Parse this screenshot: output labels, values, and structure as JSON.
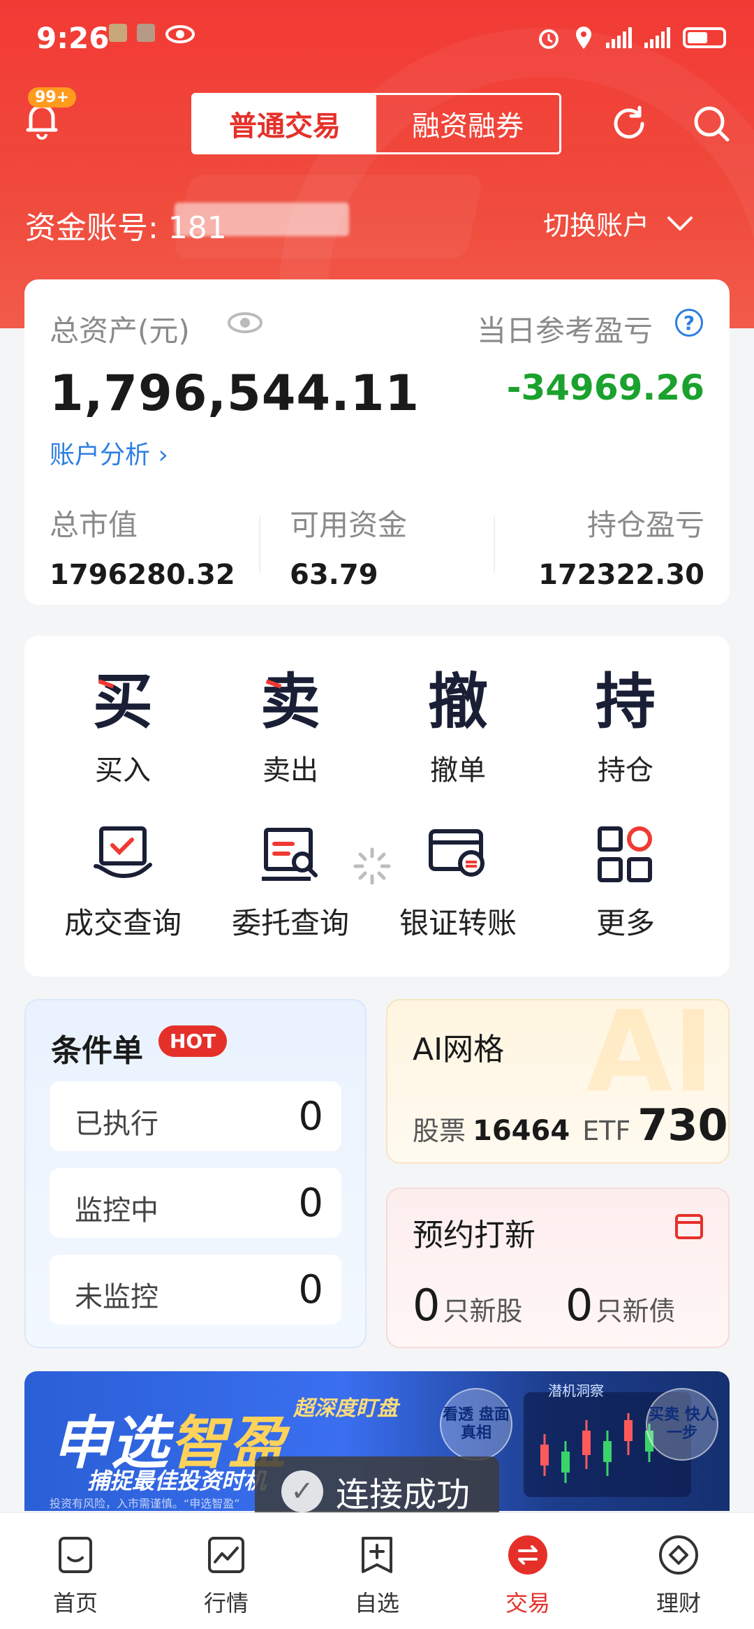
{
  "status_bar": {
    "time": "9:26"
  },
  "top_bar": {
    "badge": "99+",
    "tabs": [
      {
        "label": "普通交易",
        "active": true
      },
      {
        "label": "融资融券",
        "active": false
      }
    ]
  },
  "account": {
    "label": "资金账号: 181",
    "switch_label": "切换账户"
  },
  "assets": {
    "total_label": "总资产(元)",
    "total_value": "1,796,544.11",
    "daily_pnl_label": "当日参考盈亏",
    "daily_pnl_value": "-34969.26",
    "analysis_link": "账户分析",
    "stats": [
      {
        "label": "总市值",
        "value": "1796280.32"
      },
      {
        "label": "可用资金",
        "value": "63.79"
      },
      {
        "label": "持仓盈亏",
        "value": "172322.30"
      }
    ]
  },
  "functions": {
    "row1": [
      {
        "glyph": "买",
        "label": "买入"
      },
      {
        "glyph": "卖",
        "label": "卖出"
      },
      {
        "glyph": "撤",
        "label": "撤单"
      },
      {
        "glyph": "持",
        "label": "持仓"
      }
    ],
    "row2": [
      {
        "icon": "trade-query-icon",
        "label": "成交查询"
      },
      {
        "icon": "order-query-icon",
        "label": "委托查询"
      },
      {
        "icon": "bank-transfer-icon",
        "label": "银证转账"
      },
      {
        "icon": "more-grid-icon",
        "label": "更多"
      }
    ]
  },
  "conditional_orders": {
    "title": "条件单",
    "hot": "HOT",
    "rows": [
      {
        "label": "已执行",
        "value": "0"
      },
      {
        "label": "监控中",
        "value": "0"
      },
      {
        "label": "未监控",
        "value": "0"
      }
    ]
  },
  "ai_grid": {
    "title": "AI网格",
    "stock_label": "股票",
    "stock_value": "16464",
    "etf_label": "ETF",
    "etf_value": "730",
    "deco": "AI"
  },
  "ipo": {
    "title": "预约打新",
    "stocks_count": "0",
    "stocks_label": "只新股",
    "bonds_count": "0",
    "bonds_label": "只新债"
  },
  "banner": {
    "title_a": "申选",
    "title_b": "智盈",
    "sub1": "超深度盯盘",
    "sub2": "捕捉最佳投资时机",
    "note": "投资有风险，入市需谨慎。“申选智盈”",
    "bubble1": "看透 盘面真相",
    "bubble2": "买卖 快人一步",
    "chart_title": "潜机洞察"
  },
  "toast": {
    "text": "连接成功"
  },
  "bottom_nav": [
    {
      "label": "首页",
      "icon": "home-icon",
      "active": false
    },
    {
      "label": "行情",
      "icon": "market-icon",
      "active": false
    },
    {
      "label": "自选",
      "icon": "watchlist-icon",
      "active": false
    },
    {
      "label": "交易",
      "icon": "trade-icon",
      "active": true
    },
    {
      "label": "理财",
      "icon": "wealth-icon",
      "active": false
    }
  ],
  "colors": {
    "brand_red": "#e5302a",
    "loss_green": "#1ba12d",
    "link_blue": "#2e7fe0"
  }
}
